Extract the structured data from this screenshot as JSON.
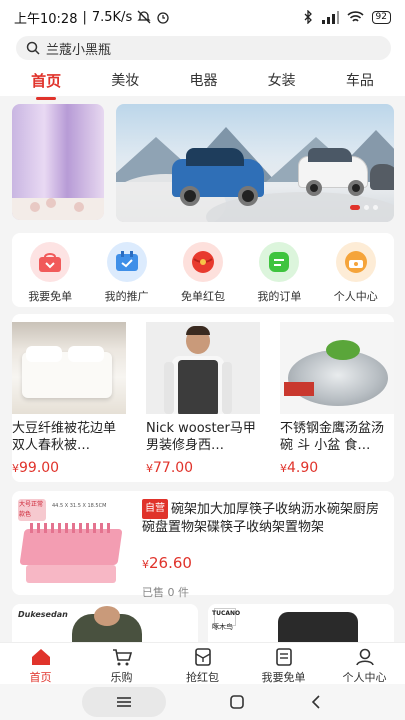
{
  "status_bar": {
    "time": "上午10:28",
    "speed": "7.5K/s",
    "battery": "92"
  },
  "search": {
    "placeholder": "兰蔻小黑瓶"
  },
  "tabs": [
    {
      "label": "首页",
      "active": true
    },
    {
      "label": "美妆",
      "active": false
    },
    {
      "label": "电器",
      "active": false
    },
    {
      "label": "女装",
      "active": false
    },
    {
      "label": "车品",
      "active": false
    }
  ],
  "quick_actions": [
    {
      "label": "我要免单",
      "icon": "free-order-icon",
      "color": "#f15a5a"
    },
    {
      "label": "我的推广",
      "icon": "promotion-icon",
      "color": "#3f8fe8"
    },
    {
      "label": "免单红包",
      "icon": "red-packet-icon",
      "color": "#e83a2e"
    },
    {
      "label": "我的订单",
      "icon": "order-icon",
      "color": "#3ec43e"
    },
    {
      "label": "个人中心",
      "icon": "user-center-icon",
      "color": "#f5a43a"
    }
  ],
  "products": [
    {
      "title": "大豆纤维被花边单双人春秋被…",
      "currency": "¥",
      "price": "99.00"
    },
    {
      "title": "Nick wooster马甲男装修身西…",
      "currency": "¥",
      "price": "77.00"
    },
    {
      "title": "不锈钢金鹰汤盆汤碗 斗 小盆 食…",
      "currency": "¥",
      "price": "4.90"
    }
  ],
  "feature": {
    "tag": "自营",
    "title": "碗架加大加厚筷子收纳沥水碗架厨房碗盘置物架碟筷子收纳架置物架",
    "currency": "¥",
    "price": "26.60",
    "sold": "已售 0 件",
    "image_label": "大号正常款色",
    "image_size": "44.5 X 31.5 X 18.5CM"
  },
  "partials": {
    "brand_left": "Dukesedan",
    "brand_right": "TUCANO",
    "brand_right_cn": "啄木鸟"
  },
  "bottom_nav": [
    {
      "label": "首页",
      "icon": "home-icon",
      "active": true
    },
    {
      "label": "乐购",
      "icon": "cart-icon",
      "active": false
    },
    {
      "label": "抢红包",
      "icon": "red-envelope-icon",
      "active": false
    },
    {
      "label": "我要免单",
      "icon": "free-order-doc-icon",
      "active": false
    },
    {
      "label": "个人中心",
      "icon": "profile-icon",
      "active": false
    }
  ],
  "colors": {
    "accent": "#e0332b"
  }
}
